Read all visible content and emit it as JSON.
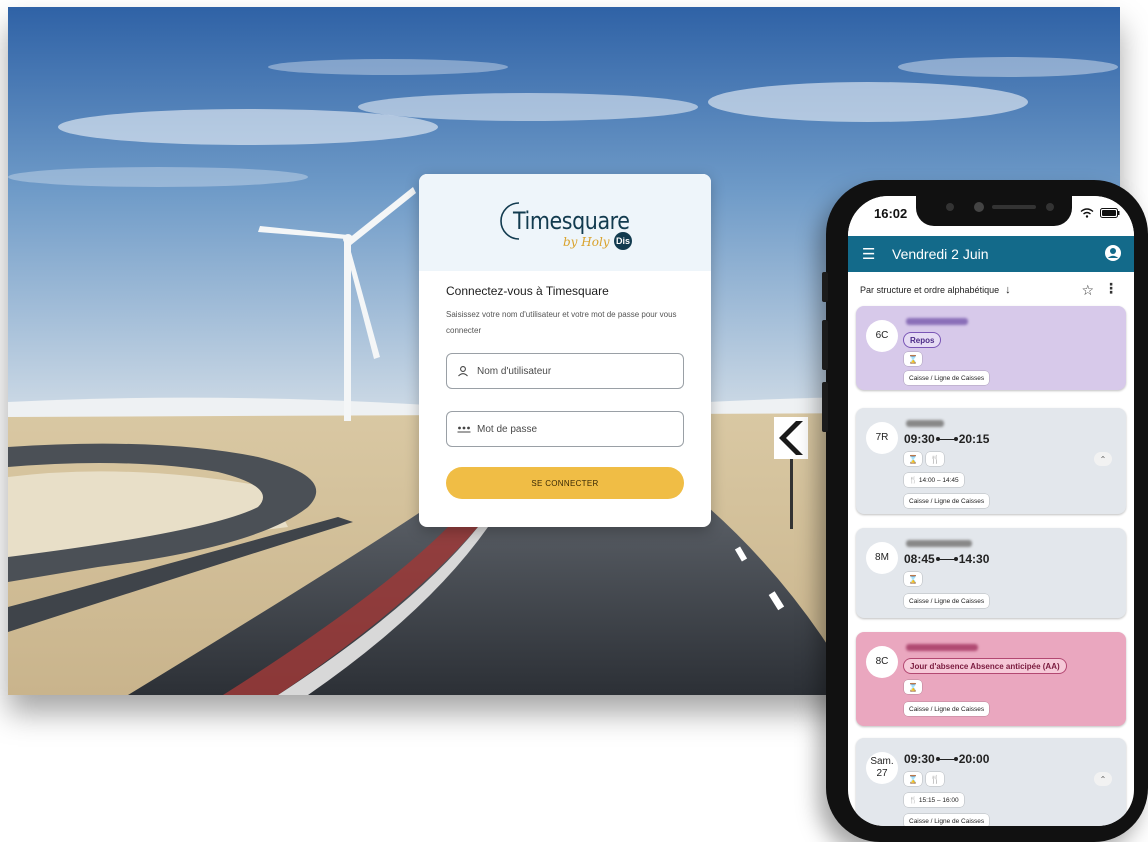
{
  "login": {
    "logo_title": "Timesquare",
    "logo_by": "by Holy",
    "logo_badge": "Dis",
    "heading": "Connectez-vous à Timesquare",
    "subtitle": "Saisissez votre nom d'utilisateur et votre mot de passe pour vous connecter",
    "username_placeholder": "Nom d'utilisateur",
    "password_placeholder": "Mot de passe",
    "submit_label": "SE CONNECTER"
  },
  "phone": {
    "status_time": "16:02",
    "app_title": "Vendredi 2 Juin",
    "sort_label": "Par structure et ordre alphabétique",
    "cards": [
      {
        "day": "6C",
        "tag": "Repos",
        "location": "Caisse / Ligne de Caisses"
      },
      {
        "day": "7R",
        "start": "09:30",
        "end": "20:15",
        "break": "14:00 – 14:45",
        "location": "Caisse / Ligne de Caisses"
      },
      {
        "day": "8M",
        "start": "08:45",
        "end": "14:30",
        "location": "Caisse / Ligne de Caisses"
      },
      {
        "day": "8C",
        "tag": "Jour d'absence Absence anticipée (AA)",
        "location": "Caisse / Ligne de Caisses"
      },
      {
        "day_line1": "Sam.",
        "day_line2": "27",
        "start": "09:30",
        "end": "20:00",
        "break": "15:15 – 16:00",
        "location": "Caisse / Ligne de Caisses"
      }
    ]
  },
  "colors": {
    "app_bar": "#136a8a",
    "button": "#f0bd45",
    "repos_card": "#d7c9ea",
    "absence_card": "#eaa7bf",
    "default_card": "#e3e7ec"
  }
}
